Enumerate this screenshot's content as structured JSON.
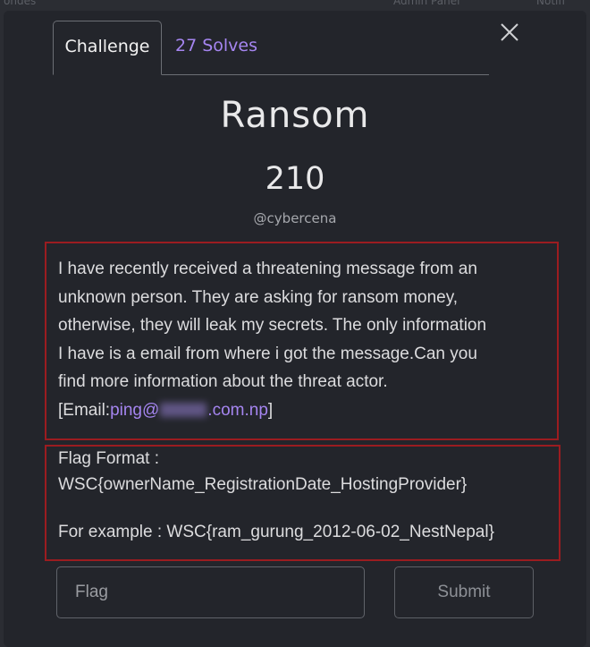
{
  "background": {
    "left_text": "ondes",
    "right_text": "Admin Panel",
    "far_right_text": "Notifi"
  },
  "tabs": [
    {
      "label": "Challenge",
      "active": true
    },
    {
      "label": "27 Solves",
      "active": false
    }
  ],
  "challenge": {
    "name": "Ransom",
    "points": "210",
    "author": "@cybercena",
    "description_lines": [
      "I have recently received a threatening message from an",
      "unknown person. They are asking for ransom money,",
      "otherwise, they will leak my secrets. The only information",
      "I have is a email from where i got the message.Can you",
      "find more information about the threat actor."
    ],
    "email_prefix": "[Email:",
    "email_user": "ping@",
    "email_domain": ".com.np",
    "email_suffix": "]",
    "flag_format_label": "Flag Format :",
    "flag_format": "WSC{ownerName_RegistrationDate_HostingProvider}",
    "example": "For example : WSC{ram_gurung_2012-06-02_NestNepal}"
  },
  "form": {
    "placeholder": "Flag",
    "submit_label": "Submit"
  },
  "colors": {
    "accent": "#a585f0",
    "highlight_border": "#9b1c20",
    "background": "#23252b"
  },
  "icons": {
    "close": "close-icon"
  }
}
